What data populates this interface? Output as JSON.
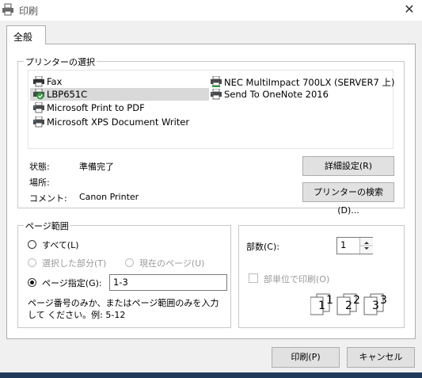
{
  "window": {
    "title": "印刷",
    "close_symbol": "✕"
  },
  "tabs": [
    {
      "label": "全般"
    }
  ],
  "printer_group": {
    "title": "プリンターの選択",
    "printers": [
      {
        "name": "Fax",
        "icon": "fax-printer-icon",
        "selected": false,
        "default": false
      },
      {
        "name": "LBP651C",
        "icon": "printer-default-icon",
        "selected": true,
        "default": true
      },
      {
        "name": "Microsoft Print to PDF",
        "icon": "printer-icon",
        "selected": false,
        "default": false
      },
      {
        "name": "Microsoft XPS Document Writer",
        "icon": "printer-icon",
        "selected": false,
        "default": false
      },
      {
        "name": "NEC MultiImpact 700LX (SERVER7 上)",
        "icon": "network-printer-icon",
        "selected": false,
        "default": false
      },
      {
        "name": "Send To OneNote 2016",
        "icon": "printer-icon",
        "selected": false,
        "default": false
      }
    ],
    "status_label": "状態:",
    "status_value": "準備完了",
    "location_label": "場所:",
    "location_value": "",
    "comment_label": "コメント:",
    "comment_value": "Canon Printer",
    "preferences_button": "詳細設定(R)",
    "find_printer_button": "プリンターの検索(D)..."
  },
  "page_range": {
    "title": "ページ範囲",
    "all_label": "すべて(L)",
    "selection_label": "選択した部分(T)",
    "current_page_label": "現在のページ(U)",
    "pages_label": "ページ指定(G):",
    "pages_value": "1-3",
    "hint": "ページ番号のみか、またはページ範囲のみを入力して ください。例: 5-12"
  },
  "copies": {
    "label": "部数(C):",
    "value": "1",
    "collate_label": "部単位で印刷(O)",
    "collate_pages": [
      "1",
      "1",
      "2",
      "2",
      "3",
      "3"
    ]
  },
  "buttons": {
    "print": "印刷(P)",
    "cancel": "キャンセル"
  },
  "colors": {
    "selection": "#d9d9d9",
    "taskbar": "#1f3a5a",
    "check_green": "#2e9b3e"
  }
}
